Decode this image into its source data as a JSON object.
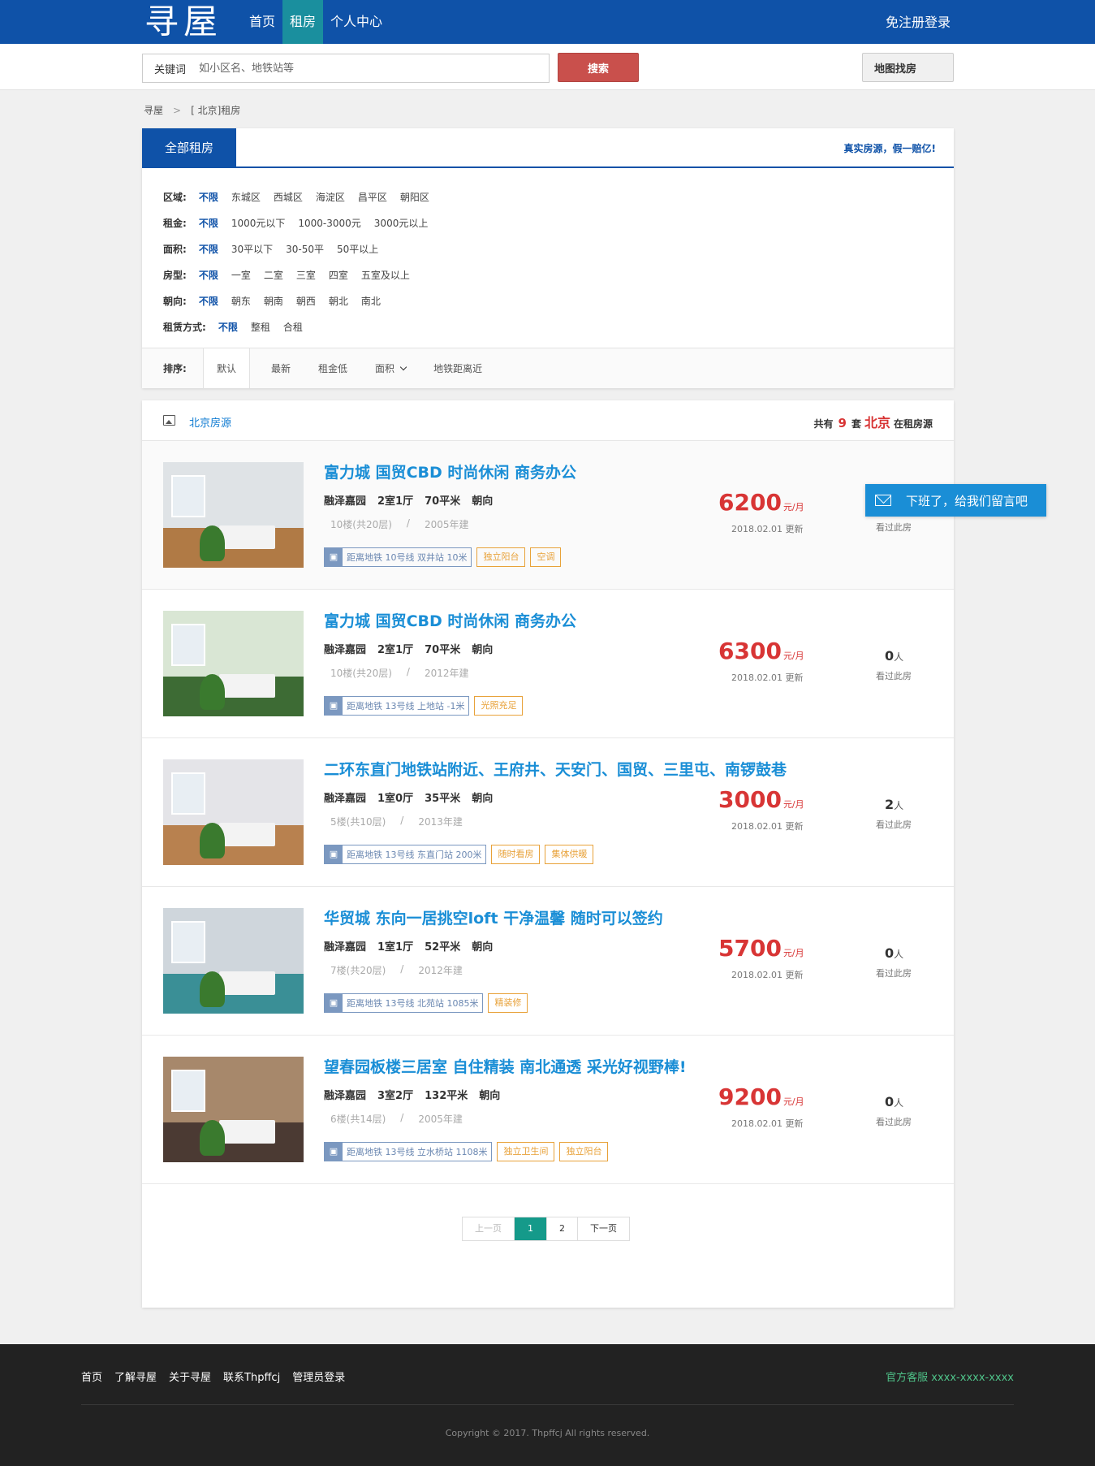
{
  "brand": {
    "logo": "寻屋"
  },
  "nav": {
    "items": [
      "首页",
      "租房",
      "个人中心"
    ],
    "active_index": 1,
    "login": "免注册登录"
  },
  "search": {
    "label": "关键词",
    "placeholder": "如小区名、地铁站等",
    "button": "搜索",
    "map_button": "地图找房"
  },
  "breadcrumb": [
    "寻屋",
    "[ 北京]租房"
  ],
  "filter": {
    "tab": "全部租房",
    "slogan": "真实房源，假一赔亿!",
    "rows": [
      {
        "label": "区域:",
        "options": [
          "不限",
          "东城区",
          "西城区",
          "海淀区",
          "昌平区",
          "朝阳区"
        ]
      },
      {
        "label": "租金:",
        "options": [
          "不限",
          "1000元以下",
          "1000-3000元",
          "3000元以上"
        ]
      },
      {
        "label": "面积:",
        "options": [
          "不限",
          "30平以下",
          "30-50平",
          "50平以上"
        ]
      },
      {
        "label": "房型:",
        "options": [
          "不限",
          "一室",
          "二室",
          "三室",
          "四室",
          "五室及以上"
        ]
      },
      {
        "label": "朝向:",
        "options": [
          "不限",
          "朝东",
          "朝南",
          "朝西",
          "朝北",
          "南北"
        ]
      },
      {
        "label": "租赁方式:",
        "options": [
          "不限",
          "整租",
          "合租"
        ]
      }
    ],
    "sort_label": "排序:",
    "sort_options": [
      "默认",
      "最新",
      "租金低",
      "面积",
      "地铁距离近"
    ]
  },
  "list": {
    "title": "北京房源",
    "count_prefix": "共有",
    "count": "9",
    "count_unit": "套",
    "city": "北京",
    "count_suffix": "在租房源",
    "items": [
      {
        "title": "富力城 国贸CBD 时尚休闲 商务办公",
        "community": "融泽嘉园",
        "layout": "2室1厅",
        "area": "70平米",
        "direction": "朝向",
        "floor": "10楼(共20层)",
        "sep": "/",
        "built": "2005年建",
        "metro": "距离地铁 10号线 双井站 10米",
        "tags": [
          "独立阳台",
          "空调"
        ],
        "price": "6200",
        "price_unit": "元/月",
        "updated": "2018.02.01 更新",
        "views": "",
        "views_unit": "",
        "views_label": "看过此房",
        "colors": {
          "wall": "#dfe3e6",
          "floor": "#b07a45"
        }
      },
      {
        "title": "富力城 国贸CBD 时尚休闲 商务办公",
        "community": "融泽嘉园",
        "layout": "2室1厅",
        "area": "70平米",
        "direction": "朝向",
        "floor": "10楼(共20层)",
        "sep": "/",
        "built": "2012年建",
        "metro": "距离地铁 13号线 上地站 -1米",
        "tags": [
          "光照充足"
        ],
        "price": "6300",
        "price_unit": "元/月",
        "updated": "2018.02.01 更新",
        "views": "0",
        "views_unit": "人",
        "views_label": "看过此房",
        "colors": {
          "wall": "#d9e6d4",
          "floor": "#3d6b34"
        }
      },
      {
        "title": "二环东直门地铁站附近、王府井、天安门、国贸、三里屯、南锣鼓巷",
        "community": "融泽嘉园",
        "layout": "1室0厅",
        "area": "35平米",
        "direction": "朝向",
        "floor": "5楼(共10层)",
        "sep": "/",
        "built": "2013年建",
        "metro": "距离地铁 13号线 东直门站 200米",
        "tags": [
          "随时看房",
          "集体供暖"
        ],
        "price": "3000",
        "price_unit": "元/月",
        "updated": "2018.02.01 更新",
        "views": "2",
        "views_unit": "人",
        "views_label": "看过此房",
        "colors": {
          "wall": "#e4e4e8",
          "floor": "#b8814f"
        }
      },
      {
        "title": "华贸城 东向一居挑空loft 干净温馨 随时可以签约",
        "community": "融泽嘉园",
        "layout": "1室1厅",
        "area": "52平米",
        "direction": "朝向",
        "floor": "7楼(共20层)",
        "sep": "/",
        "built": "2012年建",
        "metro": "距离地铁 13号线 北苑站 1085米",
        "tags": [
          "精装修"
        ],
        "price": "5700",
        "price_unit": "元/月",
        "updated": "2018.02.01 更新",
        "views": "0",
        "views_unit": "人",
        "views_label": "看过此房",
        "colors": {
          "wall": "#cfd6dc",
          "floor": "#3a8f96"
        }
      },
      {
        "title": "望春园板楼三居室 自住精装 南北通透 采光好视野棒!",
        "community": "融泽嘉园",
        "layout": "3室2厅",
        "area": "132平米",
        "direction": "朝向",
        "floor": "6楼(共14层)",
        "sep": "/",
        "built": "2005年建",
        "metro": "距离地铁 13号线 立水桥站 1108米",
        "tags": [
          "独立卫生间",
          "独立阳台"
        ],
        "price": "9200",
        "price_unit": "元/月",
        "updated": "2018.02.01 更新",
        "views": "0",
        "views_unit": "人",
        "views_label": "看过此房",
        "colors": {
          "wall": "#a7886b",
          "floor": "#4b3a33"
        }
      }
    ]
  },
  "pager": {
    "prev": "上一页",
    "pages": [
      "1",
      "2"
    ],
    "current": "1",
    "next": "下一页"
  },
  "float_msg": "下班了，给我们留言吧",
  "footer": {
    "links": [
      "首页",
      "了解寻屋",
      "关于寻屋",
      "联系Thpffcj",
      "管理员登录"
    ],
    "service": "官方客服 xxxx-xxxx-xxxx",
    "copyright": "Copyright © 2017. Thpffcj All rights reserved."
  },
  "colors": {
    "primary": "#0f52a8",
    "accent": "#1a8ed6",
    "price": "#d83535",
    "search_button": "#c9504c",
    "tag": "#e8a23a",
    "pager_active": "#159a8a"
  }
}
